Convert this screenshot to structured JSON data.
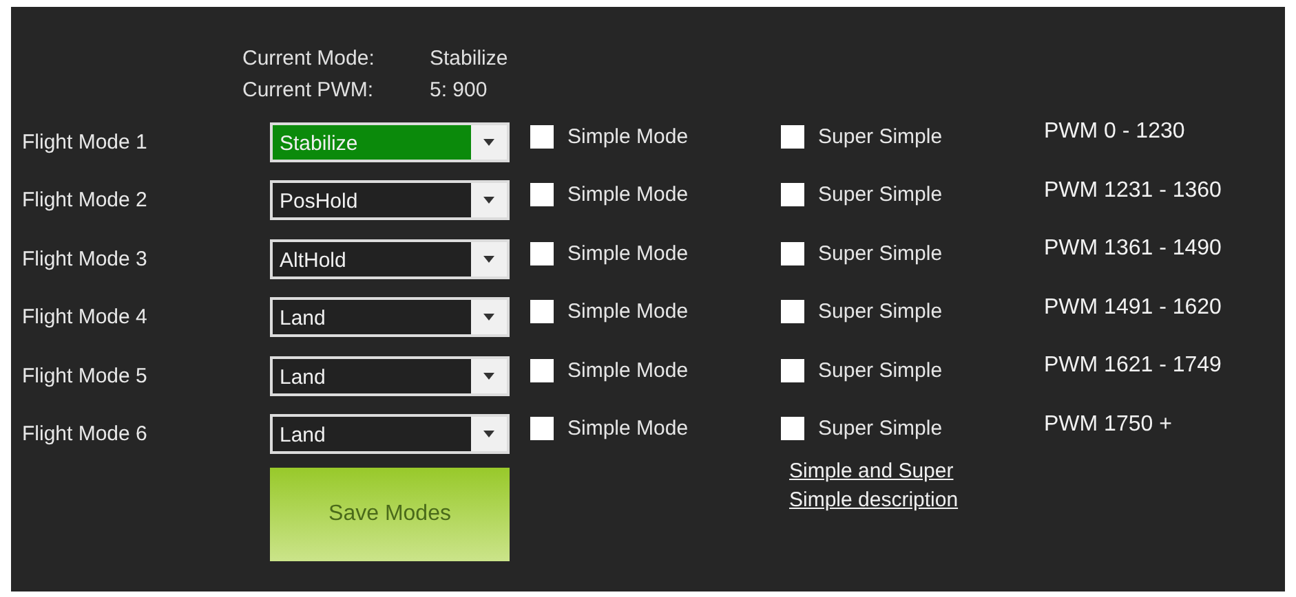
{
  "status": {
    "mode_label": "Current Mode:",
    "mode_value": "Stabilize",
    "pwm_label": "Current PWM:",
    "pwm_value": "5: 900"
  },
  "modes": [
    {
      "label": "Flight Mode 1",
      "value": "Stabilize",
      "active": true,
      "simple": {
        "label": "Simple Mode",
        "checked": false
      },
      "super_simple": {
        "label": "Super Simple",
        "checked": false
      },
      "pwm_range": "PWM 0 - 1230"
    },
    {
      "label": "Flight Mode 2",
      "value": "PosHold",
      "active": false,
      "simple": {
        "label": "Simple Mode",
        "checked": false
      },
      "super_simple": {
        "label": "Super Simple",
        "checked": false
      },
      "pwm_range": "PWM 1231 - 1360"
    },
    {
      "label": "Flight Mode 3",
      "value": "AltHold",
      "active": false,
      "simple": {
        "label": "Simple Mode",
        "checked": false
      },
      "super_simple": {
        "label": "Super Simple",
        "checked": false
      },
      "pwm_range": "PWM 1361 - 1490"
    },
    {
      "label": "Flight Mode 4",
      "value": "Land",
      "active": false,
      "simple": {
        "label": "Simple Mode",
        "checked": false
      },
      "super_simple": {
        "label": "Super Simple",
        "checked": false
      },
      "pwm_range": "PWM 1491 - 1620"
    },
    {
      "label": "Flight Mode 5",
      "value": "Land",
      "active": false,
      "simple": {
        "label": "Simple Mode",
        "checked": false
      },
      "super_simple": {
        "label": "Super Simple",
        "checked": false
      },
      "pwm_range": "PWM 1621 - 1749"
    },
    {
      "label": "Flight Mode 6",
      "value": "Land",
      "active": false,
      "simple": {
        "label": "Simple Mode",
        "checked": false
      },
      "super_simple": {
        "label": "Super Simple",
        "checked": false
      },
      "pwm_range": "PWM 1750 +"
    }
  ],
  "save_button": "Save Modes",
  "help_link": "Simple and Super Simple description"
}
